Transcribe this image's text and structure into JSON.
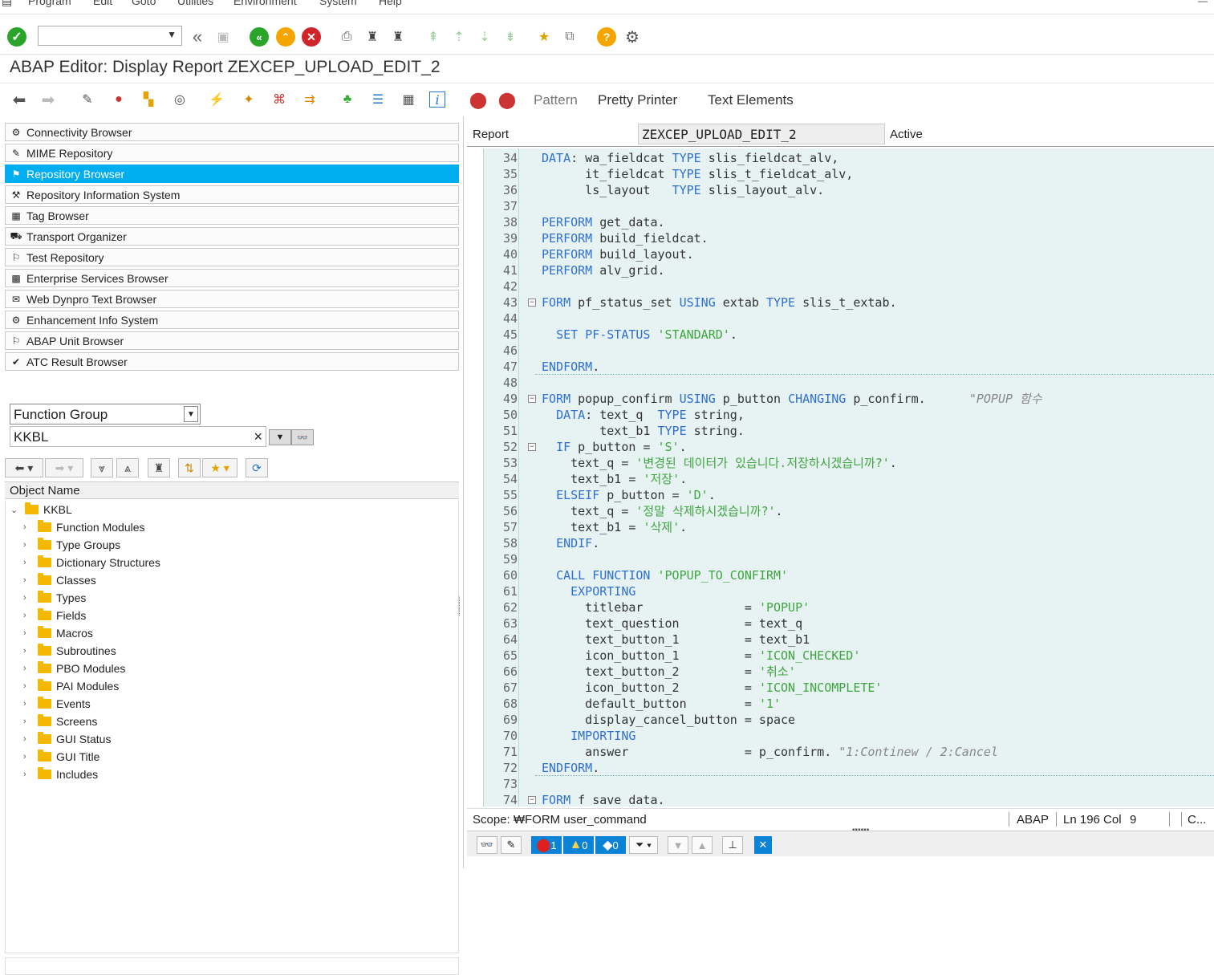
{
  "menu": [
    "Program",
    "Edit",
    "Goto",
    "Utilities",
    "Environment",
    "System",
    "Help"
  ],
  "title": "ABAP Editor: Display Report ZEXCEP_UPLOAD_EDIT_2",
  "toolbar2_text": {
    "pattern": "Pattern",
    "pretty_printer": "Pretty Printer",
    "text_elements": "Text Elements"
  },
  "nav_items": [
    {
      "label": "Connectivity Browser",
      "icon": "connectivity-icon",
      "selected": false
    },
    {
      "label": "MIME Repository",
      "icon": "mime-icon",
      "selected": false
    },
    {
      "label": "Repository Browser",
      "icon": "repository-icon",
      "selected": true
    },
    {
      "label": "Repository Information System",
      "icon": "info-system-icon",
      "selected": false
    },
    {
      "label": "Tag Browser",
      "icon": "tag-icon",
      "selected": false
    },
    {
      "label": "Transport Organizer",
      "icon": "transport-icon",
      "selected": false
    },
    {
      "label": "Test Repository",
      "icon": "test-icon",
      "selected": false
    },
    {
      "label": "Enterprise Services Browser",
      "icon": "services-icon",
      "selected": false
    },
    {
      "label": "Web Dynpro Text Browser",
      "icon": "webdynpro-icon",
      "selected": false
    },
    {
      "label": "Enhancement Info System",
      "icon": "enhancement-icon",
      "selected": false
    },
    {
      "label": "ABAP Unit Browser",
      "icon": "unit-icon",
      "selected": false
    },
    {
      "label": "ATC Result Browser",
      "icon": "atc-icon",
      "selected": false
    }
  ],
  "object_type": "Function Group",
  "object_value": "KKBL",
  "tree_header": "Object Name",
  "tree_root": "KKBL",
  "tree_children": [
    "Function Modules",
    "Type Groups",
    "Dictionary Structures",
    "Classes",
    "Types",
    "Fields",
    "Macros",
    "Subroutines",
    "PBO Modules",
    "PAI Modules",
    "Events",
    "Screens",
    "GUI Status",
    "GUI Title",
    "Includes"
  ],
  "report": {
    "label": "Report",
    "name": "ZEXCEP_UPLOAD_EDIT_2",
    "status": "Active"
  },
  "code_lines": [
    {
      "n": "34",
      "t": "DATA: wa_fieldcat TYPE slis_fieldcat_alv,"
    },
    {
      "n": "35",
      "t": "      it_fieldcat TYPE slis_t_fieldcat_alv,"
    },
    {
      "n": "36",
      "t": "      ls_layout   TYPE slis_layout_alv."
    },
    {
      "n": "37",
      "t": ""
    },
    {
      "n": "38",
      "t": "PERFORM get_data."
    },
    {
      "n": "39",
      "t": "PERFORM build_fieldcat."
    },
    {
      "n": "40",
      "t": "PERFORM build_layout."
    },
    {
      "n": "41",
      "t": "PERFORM alv_grid."
    },
    {
      "n": "42",
      "t": ""
    },
    {
      "n": "43",
      "t": "FORM pf_status_set USING extab TYPE slis_t_extab."
    },
    {
      "n": "44",
      "t": ""
    },
    {
      "n": "45",
      "t": "  SET PF-STATUS 'STANDARD'."
    },
    {
      "n": "46",
      "t": ""
    },
    {
      "n": "47",
      "t": "ENDFORM."
    },
    {
      "n": "48",
      "t": ""
    },
    {
      "n": "49",
      "t": "FORM popup_confirm USING p_button CHANGING p_confirm.      \"POPUP 함수"
    },
    {
      "n": "50",
      "t": "  DATA: text_q  TYPE string,"
    },
    {
      "n": "51",
      "t": "        text_b1 TYPE string."
    },
    {
      "n": "52",
      "t": "  IF p_button = 'S'."
    },
    {
      "n": "53",
      "t": "    text_q = '변경된 데이터가 있습니다.저장하시겠습니까?'."
    },
    {
      "n": "54",
      "t": "    text_b1 = '저장'."
    },
    {
      "n": "55",
      "t": "  ELSEIF p_button = 'D'."
    },
    {
      "n": "56",
      "t": "    text_q = '정말 삭제하시겠습니까?'."
    },
    {
      "n": "57",
      "t": "    text_b1 = '삭제'."
    },
    {
      "n": "58",
      "t": "  ENDIF."
    },
    {
      "n": "59",
      "t": ""
    },
    {
      "n": "60",
      "t": "  CALL FUNCTION 'POPUP_TO_CONFIRM'"
    },
    {
      "n": "61",
      "t": "    EXPORTING"
    },
    {
      "n": "62",
      "t": "      titlebar              = 'POPUP'"
    },
    {
      "n": "63",
      "t": "      text_question         = text_q"
    },
    {
      "n": "64",
      "t": "      text_button_1         = text_b1"
    },
    {
      "n": "65",
      "t": "      icon_button_1         = 'ICON_CHECKED'"
    },
    {
      "n": "66",
      "t": "      text_button_2         = '취소'"
    },
    {
      "n": "67",
      "t": "      icon_button_2         = 'ICON_INCOMPLETE'"
    },
    {
      "n": "68",
      "t": "      default_button        = '1'"
    },
    {
      "n": "69",
      "t": "      display_cancel_button = space"
    },
    {
      "n": "70",
      "t": "    IMPORTING"
    },
    {
      "n": "71",
      "t": "      answer                = p_confirm. \"1:Continew / 2:Cancel"
    },
    {
      "n": "72",
      "t": "ENDFORM."
    },
    {
      "n": "73",
      "t": ""
    },
    {
      "n": "74",
      "t": "FORM f_save_data."
    }
  ],
  "status": {
    "scope": "Scope: ₩FORM user_command",
    "lang": "ABAP",
    "pos": "Ln 196 Col",
    "col": "9",
    "extra": "C..."
  },
  "bottom_counts": {
    "errors": "1",
    "warnings": "0",
    "infos": "0"
  }
}
